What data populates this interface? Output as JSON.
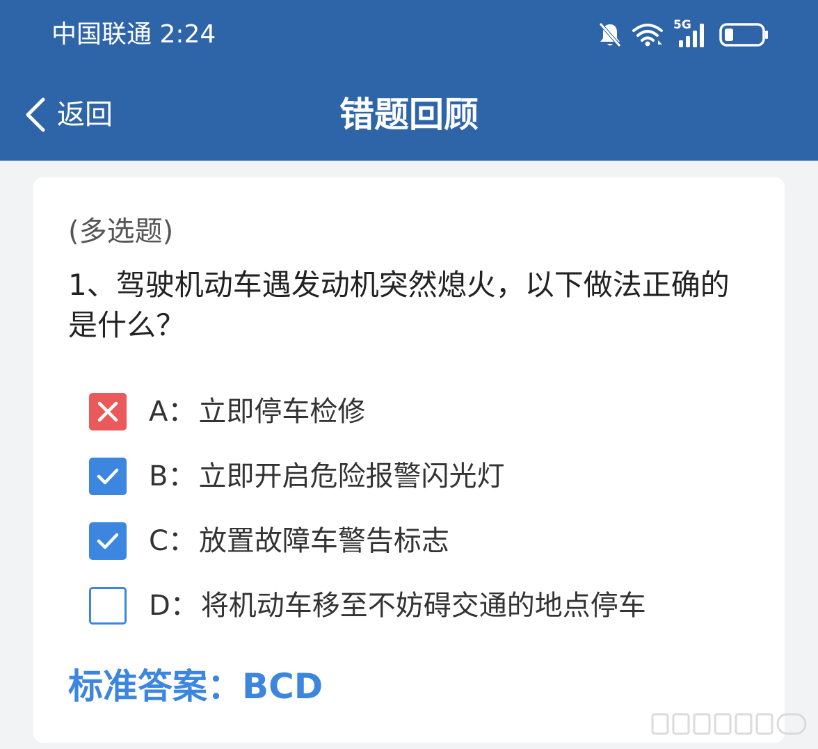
{
  "status_bar": {
    "carrier": "中国联通",
    "time": "2:24",
    "network": "5G",
    "icons": [
      "mute-bell-icon",
      "wifi-icon",
      "signal-icon",
      "battery-icon"
    ]
  },
  "nav": {
    "back_label": "返回",
    "title": "错题回顾"
  },
  "question": {
    "type": "(多选题)",
    "text": "1、驾驶机动车遇发动机突然熄火，以下做法正确的是什么？",
    "options": [
      {
        "letter": "A：",
        "text": "立即停车检修",
        "state": "wrong"
      },
      {
        "letter": "B：",
        "text": "立即开启危险报警闪光灯",
        "state": "checked"
      },
      {
        "letter": "C：",
        "text": "放置故障车警告标志",
        "state": "checked"
      },
      {
        "letter": "D：",
        "text": "将机动车移至不妨碍交通的地点停车",
        "state": "unchecked"
      }
    ],
    "answer_label": "标准答案：BCD"
  },
  "colors": {
    "header_bg": "#2e64a8",
    "accent_blue": "#3c86e0",
    "wrong_red": "#ea5a5a"
  }
}
